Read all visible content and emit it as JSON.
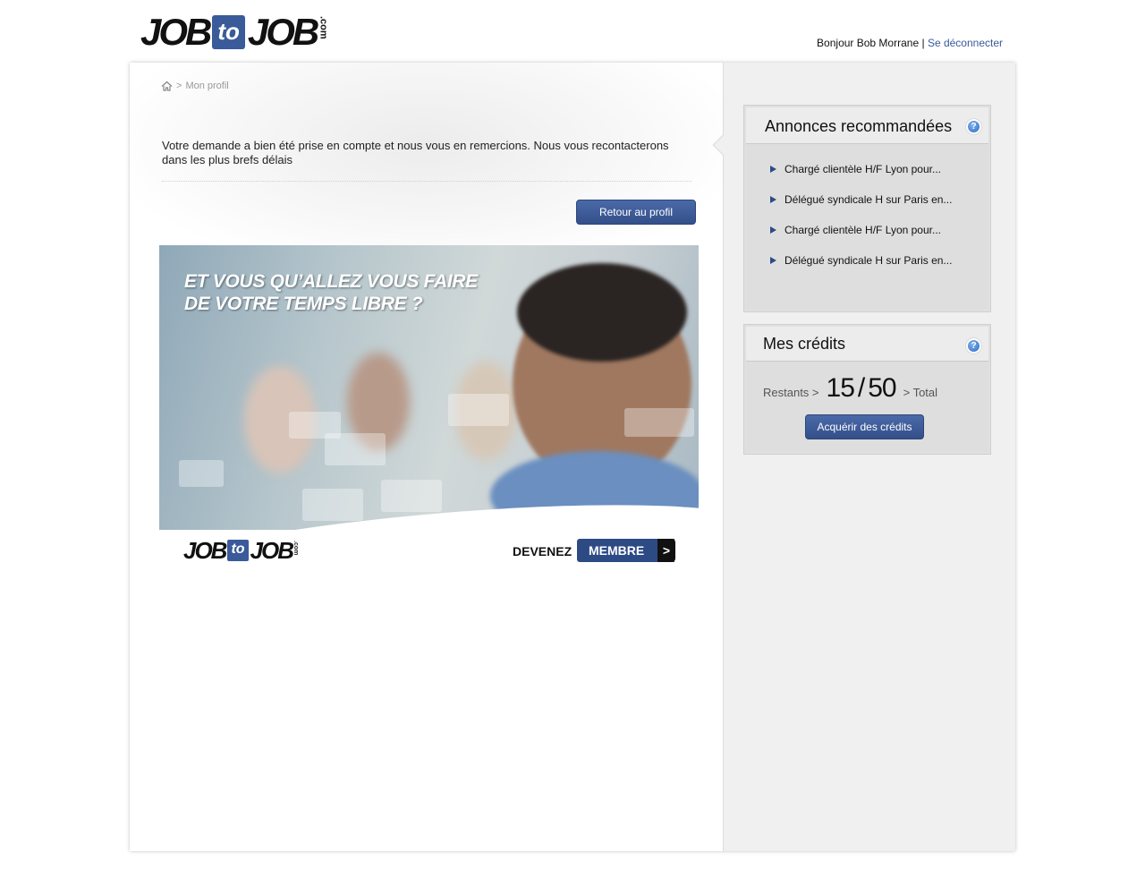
{
  "header": {
    "logo": {
      "part1": "JOB",
      "part2": "to",
      "part3": "JOB",
      "suffix": ".com"
    },
    "greeting": "Bonjour Bob Morrane",
    "separator": "|",
    "logout_label": "Se déconnecter"
  },
  "breadcrumb": {
    "home_icon": "home-icon",
    "separator": ">",
    "current": "Mon profil"
  },
  "main": {
    "message": "Votre demande a bien été prise en compte et nous vous en remercions. Nous vous recontacterons dans les plus brefs délais",
    "back_button": "Retour au profil"
  },
  "banner": {
    "headline_line1": "ET VOUS QU’ALLEZ VOUS FAIRE",
    "headline_line2": "DE VOTRE TEMPS LIBRE ?",
    "logo": {
      "part1": "JOB",
      "part2": "to",
      "part3": "JOB",
      "suffix": ".com"
    },
    "cta_prefix": "DEVENEZ",
    "cta_label": "MEMBRE",
    "cta_arrow": ">"
  },
  "sidebar": {
    "annonces": {
      "title": "Annonces recommandées",
      "help_icon": "?",
      "items": [
        {
          "label": "Chargé clientèle H/F Lyon pour..."
        },
        {
          "label": "Délégué syndicale H sur Paris en..."
        },
        {
          "label": "Chargé clientèle H/F Lyon pour..."
        },
        {
          "label": "Délégué syndicale H sur Paris en..."
        }
      ]
    },
    "credits": {
      "title": "Mes crédits",
      "help_icon": "?",
      "remaining_label": "Restants >",
      "remaining": "15",
      "slash": "/",
      "total": "50",
      "total_label": "> Total",
      "button": "Acquérir des crédits"
    }
  },
  "colors": {
    "brand_blue": "#3a5a9a",
    "button_blue": "#34508a",
    "link_blue": "#3a5a9a"
  }
}
